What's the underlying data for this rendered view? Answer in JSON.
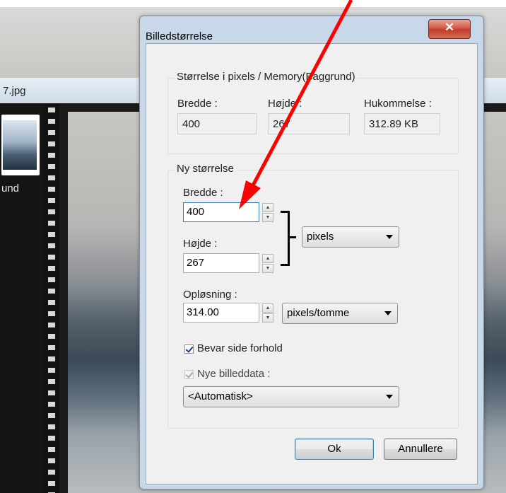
{
  "background": {
    "tab_label": "7.jpg",
    "thumb_label": "und"
  },
  "annotation_color": "#ff0000",
  "dialog": {
    "title": "Billedstørrelse",
    "close_icon": "close-icon",
    "current_size": {
      "group_title": "Størrelse i pixels / Memory(Baggrund)",
      "width_label": "Bredde :",
      "width_value": "400",
      "height_label": "Højde :",
      "height_value": "267",
      "memory_label": "Hukommelse :",
      "memory_value": "312.89 KB"
    },
    "new_size": {
      "group_title": "Ny størrelse",
      "width_label": "Bredde :",
      "width_value": "400",
      "height_label": "Højde :",
      "height_value": "267",
      "unit_selected": "pixels",
      "resolution_label": "Opløsning :",
      "resolution_value": "314.00",
      "resolution_unit_selected": "pixels/tomme",
      "keep_ratio_label": "Bevar side forhold",
      "keep_ratio_checked": true,
      "new_data_label": "Nye billeddata :",
      "new_data_checked": true,
      "new_data_enabled": false,
      "resample_selected": "<Automatisk>"
    },
    "buttons": {
      "ok": "Ok",
      "cancel": "Annullere"
    }
  }
}
